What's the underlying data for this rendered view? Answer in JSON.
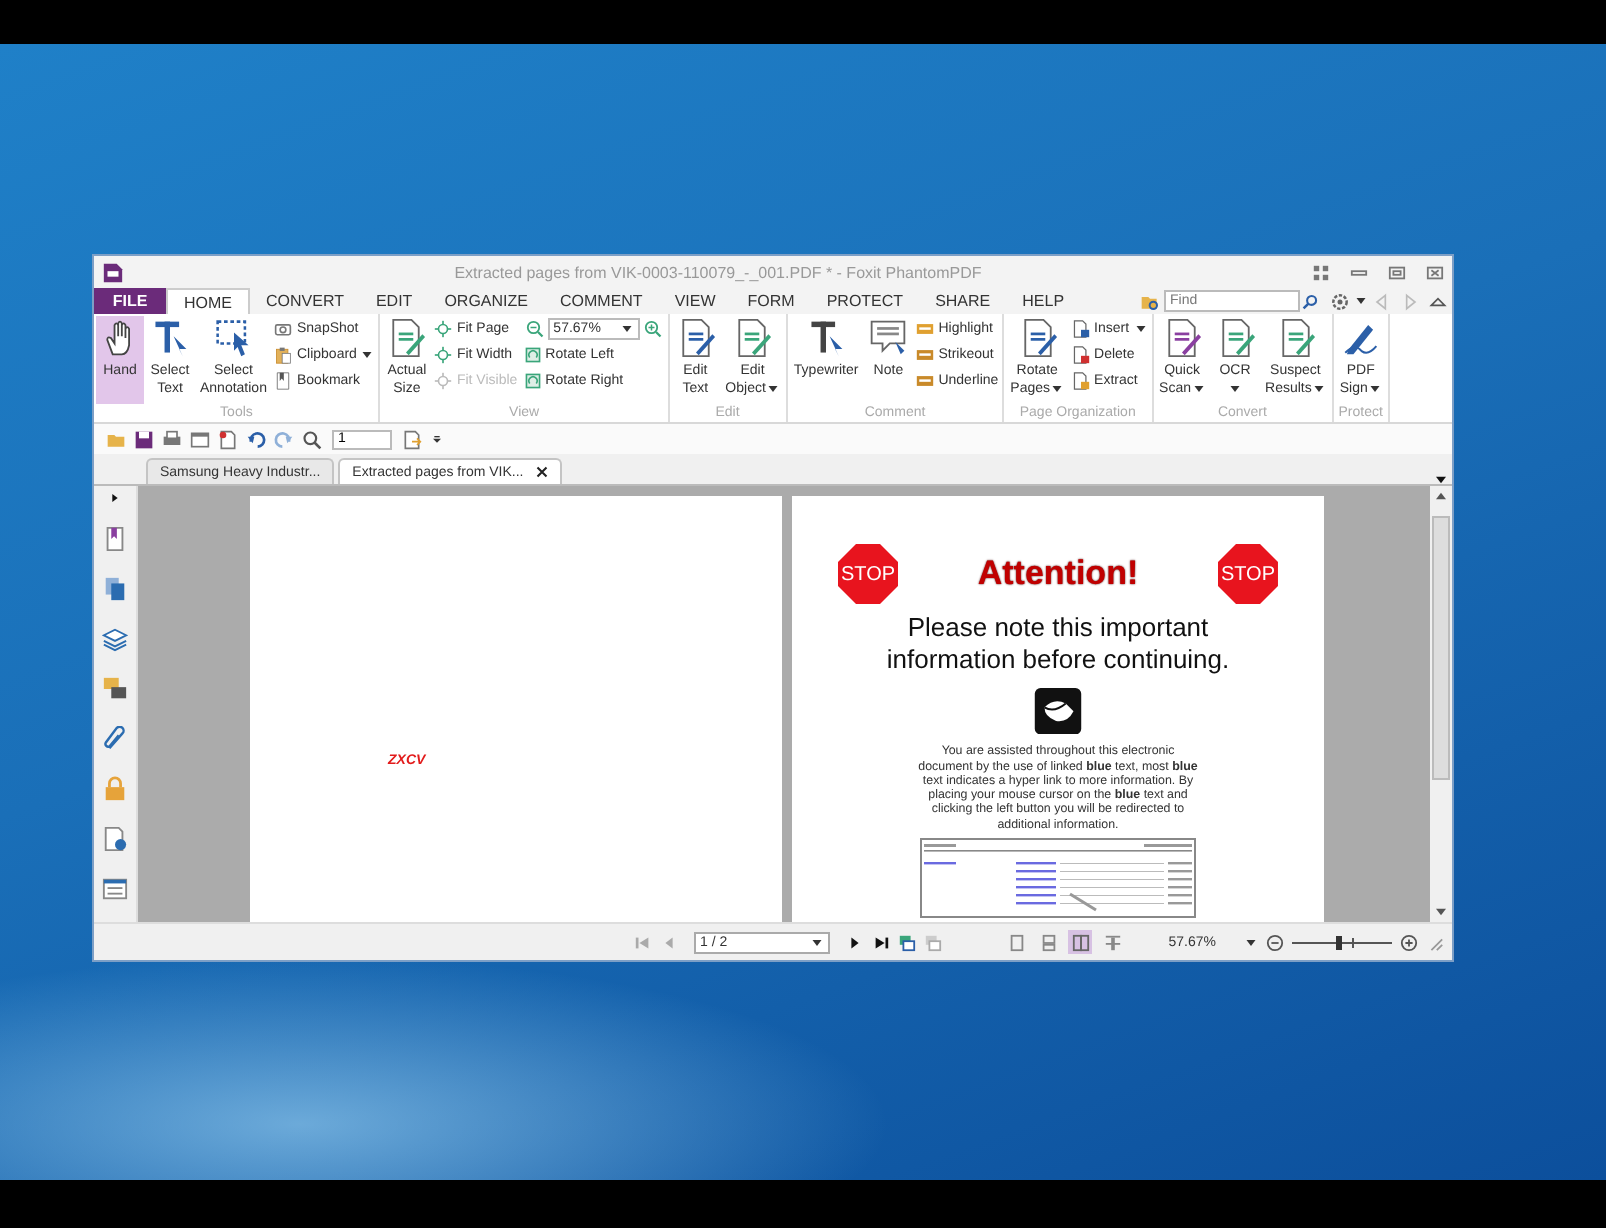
{
  "window": {
    "title": "Extracted pages from VIK-0003-110079_-_001.PDF * - Foxit PhantomPDF"
  },
  "menu_tabs": [
    {
      "label": "FILE",
      "kind": "file",
      "selected": false
    },
    {
      "label": "HOME",
      "kind": "tab",
      "selected": true
    },
    {
      "label": "CONVERT",
      "kind": "tab",
      "selected": false
    },
    {
      "label": "EDIT",
      "kind": "tab",
      "selected": false
    },
    {
      "label": "ORGANIZE",
      "kind": "tab",
      "selected": false
    },
    {
      "label": "COMMENT",
      "kind": "tab",
      "selected": false
    },
    {
      "label": "VIEW",
      "kind": "tab",
      "selected": false
    },
    {
      "label": "FORM",
      "kind": "tab",
      "selected": false
    },
    {
      "label": "PROTECT",
      "kind": "tab",
      "selected": false
    },
    {
      "label": "SHARE",
      "kind": "tab",
      "selected": false
    },
    {
      "label": "HELP",
      "kind": "tab",
      "selected": false
    }
  ],
  "find": {
    "placeholder": "Find"
  },
  "ribbon": [
    {
      "label": "Tools",
      "columns": [
        [
          {
            "kind": "big",
            "label": "Hand",
            "selected": true,
            "dropdown": false,
            "disabled": false
          }
        ],
        [
          {
            "kind": "big",
            "label": "Select\nText",
            "selected": false,
            "dropdown": false,
            "disabled": false
          }
        ],
        [
          {
            "kind": "big",
            "label": "Select\nAnnotation",
            "selected": false,
            "dropdown": false,
            "disabled": false
          }
        ],
        [
          {
            "kind": "small",
            "label": "SnapShot",
            "selected": false,
            "dropdown": false,
            "disabled": false
          },
          {
            "kind": "small",
            "label": "Clipboard",
            "selected": false,
            "dropdown": true,
            "disabled": false
          },
          {
            "kind": "small",
            "label": "Bookmark",
            "selected": false,
            "dropdown": false,
            "disabled": false
          }
        ]
      ]
    },
    {
      "label": "View",
      "columns": [
        [
          {
            "kind": "big",
            "label": "Actual\nSize",
            "selected": false,
            "dropdown": false,
            "disabled": false
          }
        ],
        [
          {
            "kind": "small",
            "label": "Fit Page",
            "selected": false,
            "dropdown": false,
            "disabled": false
          },
          {
            "kind": "small",
            "label": "Fit Width",
            "selected": false,
            "dropdown": false,
            "disabled": false
          },
          {
            "kind": "small",
            "label": "Fit Visible",
            "selected": false,
            "dropdown": false,
            "disabled": true
          }
        ],
        [
          {
            "kind": "zoom",
            "value": "57.67%"
          },
          {
            "kind": "small",
            "label": "Rotate Left",
            "selected": false,
            "dropdown": false,
            "disabled": false
          },
          {
            "kind": "small",
            "label": "Rotate Right",
            "selected": false,
            "dropdown": false,
            "disabled": false
          }
        ]
      ]
    },
    {
      "label": "Edit",
      "columns": [
        [
          {
            "kind": "big",
            "label": "Edit\nText",
            "selected": false,
            "dropdown": false,
            "disabled": false
          }
        ],
        [
          {
            "kind": "big",
            "label": "Edit\nObject",
            "selected": false,
            "dropdown": true,
            "disabled": false
          }
        ]
      ]
    },
    {
      "label": "Comment",
      "columns": [
        [
          {
            "kind": "big",
            "label": "Typewriter",
            "selected": false,
            "dropdown": false,
            "disabled": false
          }
        ],
        [
          {
            "kind": "big",
            "label": "Note",
            "selected": false,
            "dropdown": false,
            "disabled": false
          }
        ],
        [
          {
            "kind": "small",
            "label": "Highlight",
            "selected": false,
            "dropdown": false,
            "disabled": false
          },
          {
            "kind": "small",
            "label": "Strikeout",
            "selected": false,
            "dropdown": false,
            "disabled": false
          },
          {
            "kind": "small",
            "label": "Underline",
            "selected": false,
            "dropdown": false,
            "disabled": false
          }
        ]
      ]
    },
    {
      "label": "Page Organization",
      "columns": [
        [
          {
            "kind": "big",
            "label": "Rotate\nPages",
            "selected": false,
            "dropdown": true,
            "disabled": false
          }
        ],
        [
          {
            "kind": "small",
            "label": "Insert",
            "selected": false,
            "dropdown": true,
            "disabled": false
          },
          {
            "kind": "small",
            "label": "Delete",
            "selected": false,
            "dropdown": false,
            "disabled": false
          },
          {
            "kind": "small",
            "label": "Extract",
            "selected": false,
            "dropdown": false,
            "disabled": false
          }
        ]
      ]
    },
    {
      "label": "Convert",
      "columns": [
        [
          {
            "kind": "big",
            "label": "Quick\nScan",
            "selected": false,
            "dropdown": true,
            "disabled": false
          }
        ],
        [
          {
            "kind": "big",
            "label": "OCR\n",
            "selected": false,
            "dropdown": true,
            "disabled": false
          }
        ],
        [
          {
            "kind": "big",
            "label": "Suspect\nResults",
            "selected": false,
            "dropdown": true,
            "disabled": false
          }
        ]
      ]
    },
    {
      "label": "Protect",
      "columns": [
        [
          {
            "kind": "big",
            "label": "PDF\nSign",
            "selected": false,
            "dropdown": true,
            "disabled": false
          }
        ]
      ]
    }
  ],
  "quick_access": {
    "page_value": "1"
  },
  "doc_tabs": [
    {
      "label": "Samsung Heavy Industr...",
      "selected": false
    },
    {
      "label": "Extracted pages from VIK...",
      "selected": true
    }
  ],
  "left_page": {
    "annotation": "ZXCV"
  },
  "right_page": {
    "stop_signs": [
      "STOP",
      "STOP"
    ],
    "heading": "Attention!",
    "subheading": "Please note this important information before continuing.",
    "paragraph": "You are assisted throughout this electronic document by the use of linked **blue** text, most **blue** text indicates a hyper link to more information. By placing your mouse cursor on the **blue** text and clicking the left button you will be redirected to additional information."
  },
  "status_bar": {
    "page": "1 / 2",
    "zoom": "57.67%",
    "level": 0.45,
    "view_modes": [
      {
        "selected": false
      },
      {
        "selected": false
      },
      {
        "selected": true
      },
      {
        "selected": false
      }
    ]
  }
}
